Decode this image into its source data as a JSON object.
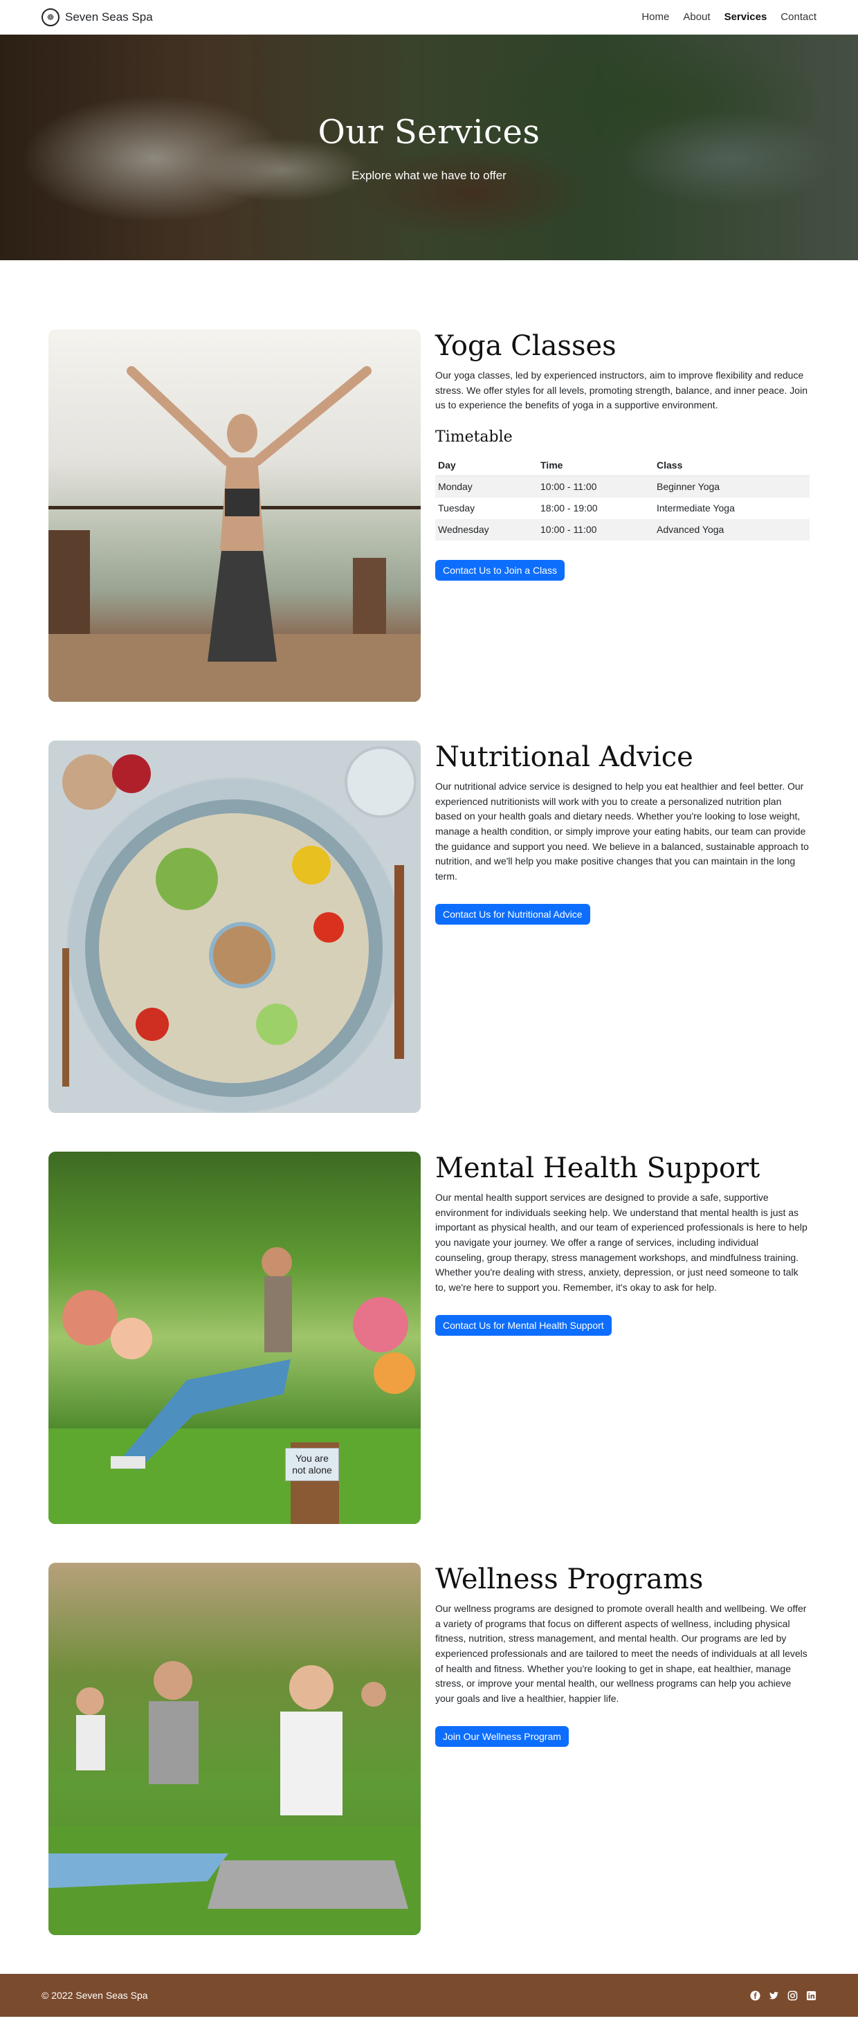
{
  "nav": {
    "brand": "Seven Seas Spa",
    "links": [
      {
        "label": "Home"
      },
      {
        "label": "About"
      },
      {
        "label": "Services"
      },
      {
        "label": "Contact"
      }
    ]
  },
  "hero": {
    "title": "Our Services",
    "subtitle": "Explore what we have to offer"
  },
  "services": [
    {
      "title": "Yoga Classes",
      "description": "Our yoga classes, led by experienced instructors, aim to improve flexibility and reduce stress. We offer styles for all levels, promoting strength, balance, and inner peace. Join us to experience the benefits of yoga in a supportive environment.",
      "timetable": {
        "title": "Timetable",
        "headers": [
          "Day",
          "Time",
          "Class"
        ],
        "rows": [
          [
            "Monday",
            "10:00 - 11:00",
            "Beginner Yoga"
          ],
          [
            "Tuesday",
            "18:00 - 19:00",
            "Intermediate Yoga"
          ],
          [
            "Wednesday",
            "10:00 - 11:00",
            "Advanced Yoga"
          ]
        ]
      },
      "button": "Contact Us to Join a Class"
    },
    {
      "title": "Nutritional Advice",
      "description": "Our nutritional advice service is designed to help you eat healthier and feel better. Our experienced nutritionists will work with you to create a personalized nutrition plan based on your health goals and dietary needs. Whether you're looking to lose weight, manage a health condition, or simply improve your eating habits, our team can provide the guidance and support you need. We believe in a balanced, sustainable approach to nutrition, and we'll help you make positive changes that you can maintain in the long term.",
      "button": "Contact Us for Nutritional Advice"
    },
    {
      "title": "Mental Health Support",
      "description": "Our mental health support services are designed to provide a safe, supportive environment for individuals seeking help. We understand that mental health is just as important as physical health, and our team of experienced professionals is here to help you navigate your journey. We offer a range of services, including individual counseling, group therapy, stress management workshops, and mindfulness training. Whether you're dealing with stress, anxiety, depression, or just need someone to talk to, we're here to support you. Remember, it's okay to ask for help.",
      "button": "Contact Us for Mental Health Support",
      "image_sign": "You are not alone"
    },
    {
      "title": "Wellness Programs",
      "description": "Our wellness programs are designed to promote overall health and wellbeing. We offer a variety of programs that focus on different aspects of wellness, including physical fitness, nutrition, stress management, and mental health. Our programs are led by experienced professionals and are tailored to meet the needs of individuals at all levels of health and fitness. Whether you're looking to get in shape, eat healthier, manage stress, or improve your mental health, our wellness programs can help you achieve your goals and live a healthier, happier life.",
      "button": "Join Our Wellness Program"
    }
  ],
  "footer": {
    "copyright": "© 2022 Seven Seas Spa",
    "social": [
      "facebook-icon",
      "twitter-icon",
      "instagram-icon",
      "linkedin-icon"
    ]
  },
  "colors": {
    "primary_button": "#0d6efd",
    "footer_bg": "#7b4b2e"
  }
}
